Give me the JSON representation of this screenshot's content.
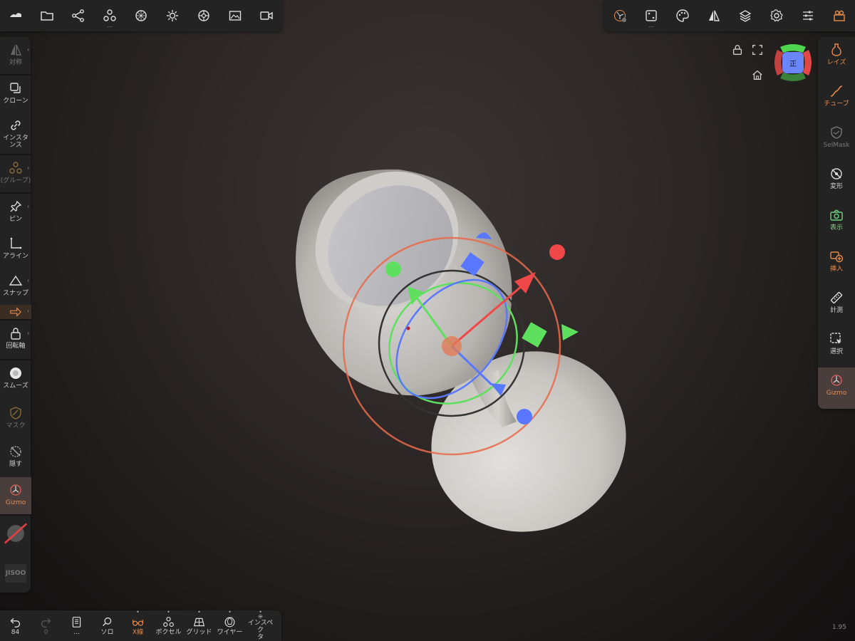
{
  "top_left_tools": [
    {
      "icon": "app-logo-icon"
    },
    {
      "icon": "folder-icon"
    },
    {
      "icon": "scene-graph-icon"
    },
    {
      "icon": "primitives-icon",
      "more": "..."
    },
    {
      "icon": "material-sphere-icon"
    },
    {
      "icon": "light-icon"
    },
    {
      "icon": "render-icon"
    },
    {
      "icon": "image-icon"
    },
    {
      "icon": "video-icon"
    }
  ],
  "top_right_tools": [
    {
      "icon": "gizmo-settings-icon"
    },
    {
      "icon": "topology-icon",
      "more": "..."
    },
    {
      "icon": "palette-icon"
    },
    {
      "icon": "symmetry-icon"
    },
    {
      "icon": "layers-icon"
    },
    {
      "icon": "settings-gear-icon"
    },
    {
      "icon": "sliders-icon"
    },
    {
      "icon": "store-icon"
    }
  ],
  "left_tools": {
    "symmetry": "対称",
    "clone": "クローン",
    "instance": "インスタ\nンス",
    "group": "(グループ)",
    "pin": "ピン",
    "align": "アライン",
    "snap": "スナップ",
    "pivot": "回転軸",
    "smooth": "スムーズ",
    "mask": "マスク",
    "hide": "隠す",
    "gizmo": "Gizmo",
    "user_label": "JISOO"
  },
  "right_tools": {
    "lathe": "レイズ",
    "tube": "チューブ",
    "selmask": "SelMask",
    "transform": "変形",
    "view": "表示",
    "insert": "挿入",
    "measure": "計測",
    "select": "選択",
    "gizmo": "Gizmo"
  },
  "bottom_tools": {
    "undo_count": "84",
    "redo_count": "0",
    "history_more": "...",
    "solo": "ソロ",
    "xray": "X線",
    "voxel": "ボクセル",
    "grid": "グリッド",
    "wireframe": "ワイヤー",
    "inspector": "インスペク\nタ"
  },
  "view_cube_label": "正",
  "zoom_level": "1.95",
  "colors": {
    "accent_orange": "#e78b4a",
    "gizmo_red": "#f04848",
    "gizmo_green": "#5ee05e",
    "gizmo_blue": "#5a78ff",
    "panel_bg": "#232323"
  }
}
